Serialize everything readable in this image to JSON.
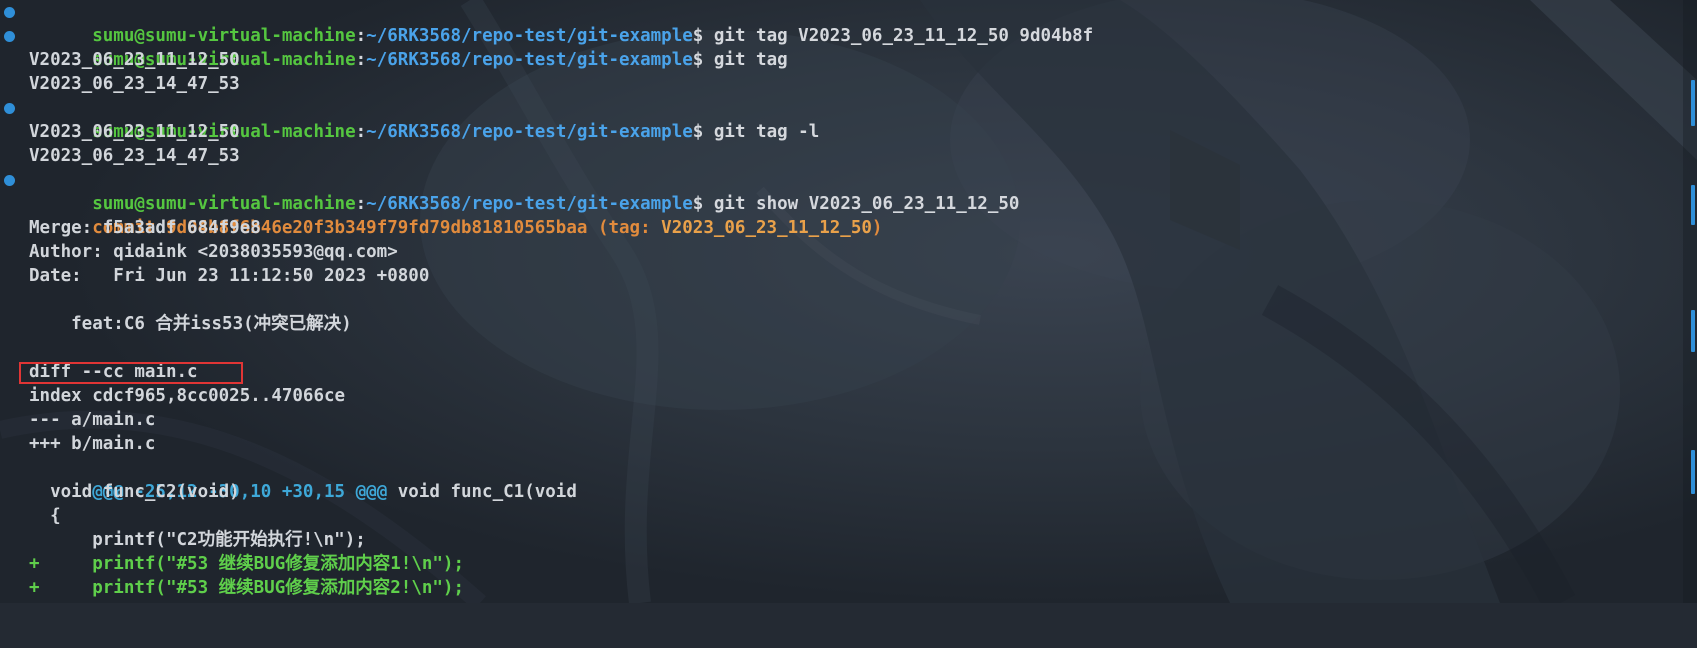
{
  "colors": {
    "user": "#55c640",
    "path": "#4aa3ea",
    "commit": "#e18b3d",
    "tag": "#e9a14a",
    "text": "#d2d6db",
    "hunk": "#3ea8d8",
    "added": "#5fcf4b",
    "highlight_box": "#e03535",
    "prompt_dot": "#2f8fd8"
  },
  "icons": {
    "prompt_marker": "dot-icon"
  },
  "terminal": {
    "prompt_user": "sumu@sumu-virtual-machine",
    "prompt_path": "~/6RK3568/repo-test/git-example",
    "prompt_symbol": "$",
    "commands": {
      "c1": "git tag V2023_06_23_11_12_50 9d04b8f",
      "c2": "git tag",
      "c3": "git tag -l",
      "c4": "git show V2023_06_23_11_12_50"
    },
    "lines": {
      "tag_a_1": "V2023_06_23_11_12_50",
      "tag_b_1": "V2023_06_23_14_47_53",
      "tag_a_2": "V2023_06_23_11_12_50",
      "tag_b_2": "V2023_06_23_14_47_53",
      "commit_prefix": "commit 9d04b8f6b46e20f3b349f79fd79db81810565baa (tag: ",
      "commit_tag": "V2023_06_23_11_12_50",
      "commit_suffix": ")",
      "merge": "Merge: f5a3adf 684f9e8",
      "author": "Author: qidaink <2038035593@qq.com>",
      "date": "Date:   Fri Jun 23 11:12:50 2023 +0800",
      "message": "    feat:C6 合并iss53(冲突已解决)",
      "diff_header": "diff --cc main.c",
      "index": "index cdcf965,8cc0025..47066ce",
      "old_file": "--- a/main.c",
      "new_file": "+++ b/main.c",
      "hunk_marker": "@@@ -25,12 -30,10 +30,15 @@@",
      "hunk_context": " void func_C1(void",
      "code_1": "  void func_C2(void)",
      "code_2": "  {",
      "code_3": "      printf(\"C2功能开始执行!\\n\");",
      "add_1": "+     printf(\"#53 继续BUG修复添加内容1!\\n\");",
      "add_2": "+     printf(\"#53 继续BUG修复添加内容2!\\n\");"
    }
  }
}
